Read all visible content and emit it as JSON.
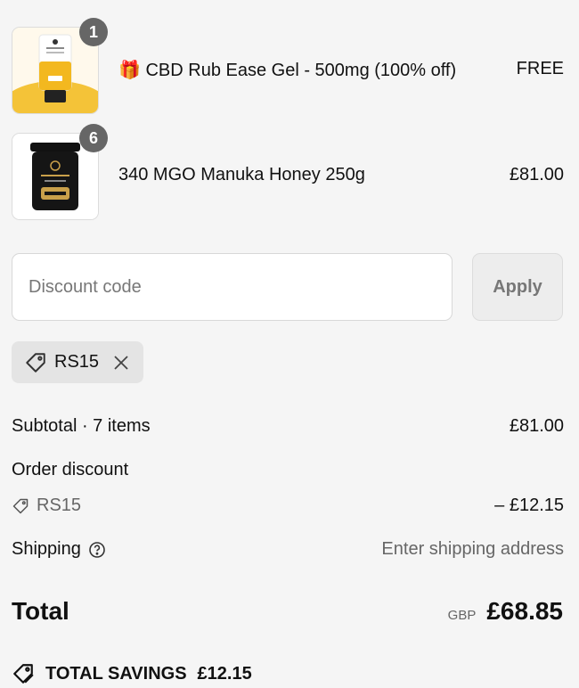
{
  "items": [
    {
      "qty": "1",
      "gift_icon": "🎁",
      "name": "CBD Rub Ease Gel - 500mg (100% off)",
      "price": "FREE"
    },
    {
      "qty": "6",
      "name": "340 MGO Manuka Honey 250g",
      "price": "£81.00"
    }
  ],
  "discount": {
    "placeholder": "Discount code",
    "value": "",
    "apply_label": "Apply",
    "applied_code": "RS15"
  },
  "summary": {
    "subtotal_label": "Subtotal · 7 items",
    "subtotal_value": "£81.00",
    "order_discount_label": "Order discount",
    "discount_code": "RS15",
    "discount_value": "– £12.15",
    "shipping_label": "Shipping",
    "shipping_value": "Enter shipping address",
    "total_label": "Total",
    "currency": "GBP",
    "total_value": "£68.85",
    "savings_label": "TOTAL SAVINGS",
    "savings_value": "£12.15"
  },
  "product_packaging": {
    "gel_label": [
      "ManukaPharm",
      "Rub Ease Gel",
      "Muscle Recovery",
      "CBD"
    ],
    "honey_label": [
      "ManukaPharm",
      "340 MGO",
      "MANUKA HONEY"
    ]
  },
  "colors": {
    "background": "#f5f5f5",
    "badge": "#666666",
    "chip": "#e4e4e4",
    "muted_text": "#666666"
  }
}
